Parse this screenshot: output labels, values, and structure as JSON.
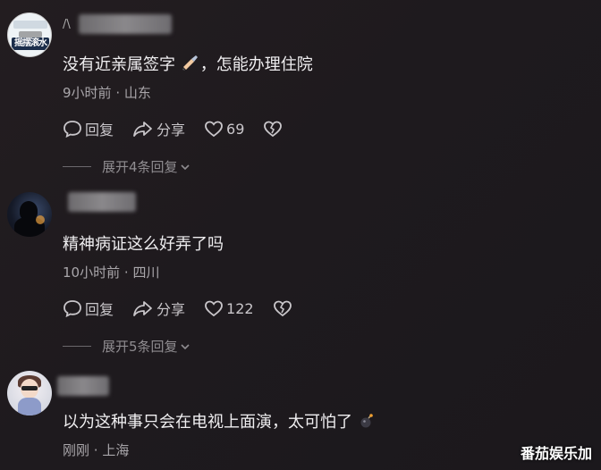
{
  "comments": [
    {
      "text": "没有近亲属签字",
      "text_tail": "，怎能办理住院",
      "emoji": "writing-hand-emoji",
      "time": "9小时前",
      "location": "山东",
      "reply_label": "回复",
      "share_label": "分享",
      "likes": "69",
      "expand_label": "展开4条回复"
    },
    {
      "text": "精神病证这么好弄了吗",
      "time": "10小时前",
      "location": "四川",
      "reply_label": "回复",
      "share_label": "分享",
      "likes": "122",
      "expand_label": "展开5条回复"
    },
    {
      "text": "以为这种事只会在电视上面演，太可怕了",
      "emoji": "bomb-emoji",
      "time": "刚刚",
      "location": "上海"
    }
  ],
  "avatar1_text": "摇摆滚水",
  "meta_separator": "·",
  "watermark": "番茄娱乐加",
  "colors": {
    "background": "#1e1a1e",
    "text": "#efeef0",
    "meta": "#a9a6aa"
  }
}
